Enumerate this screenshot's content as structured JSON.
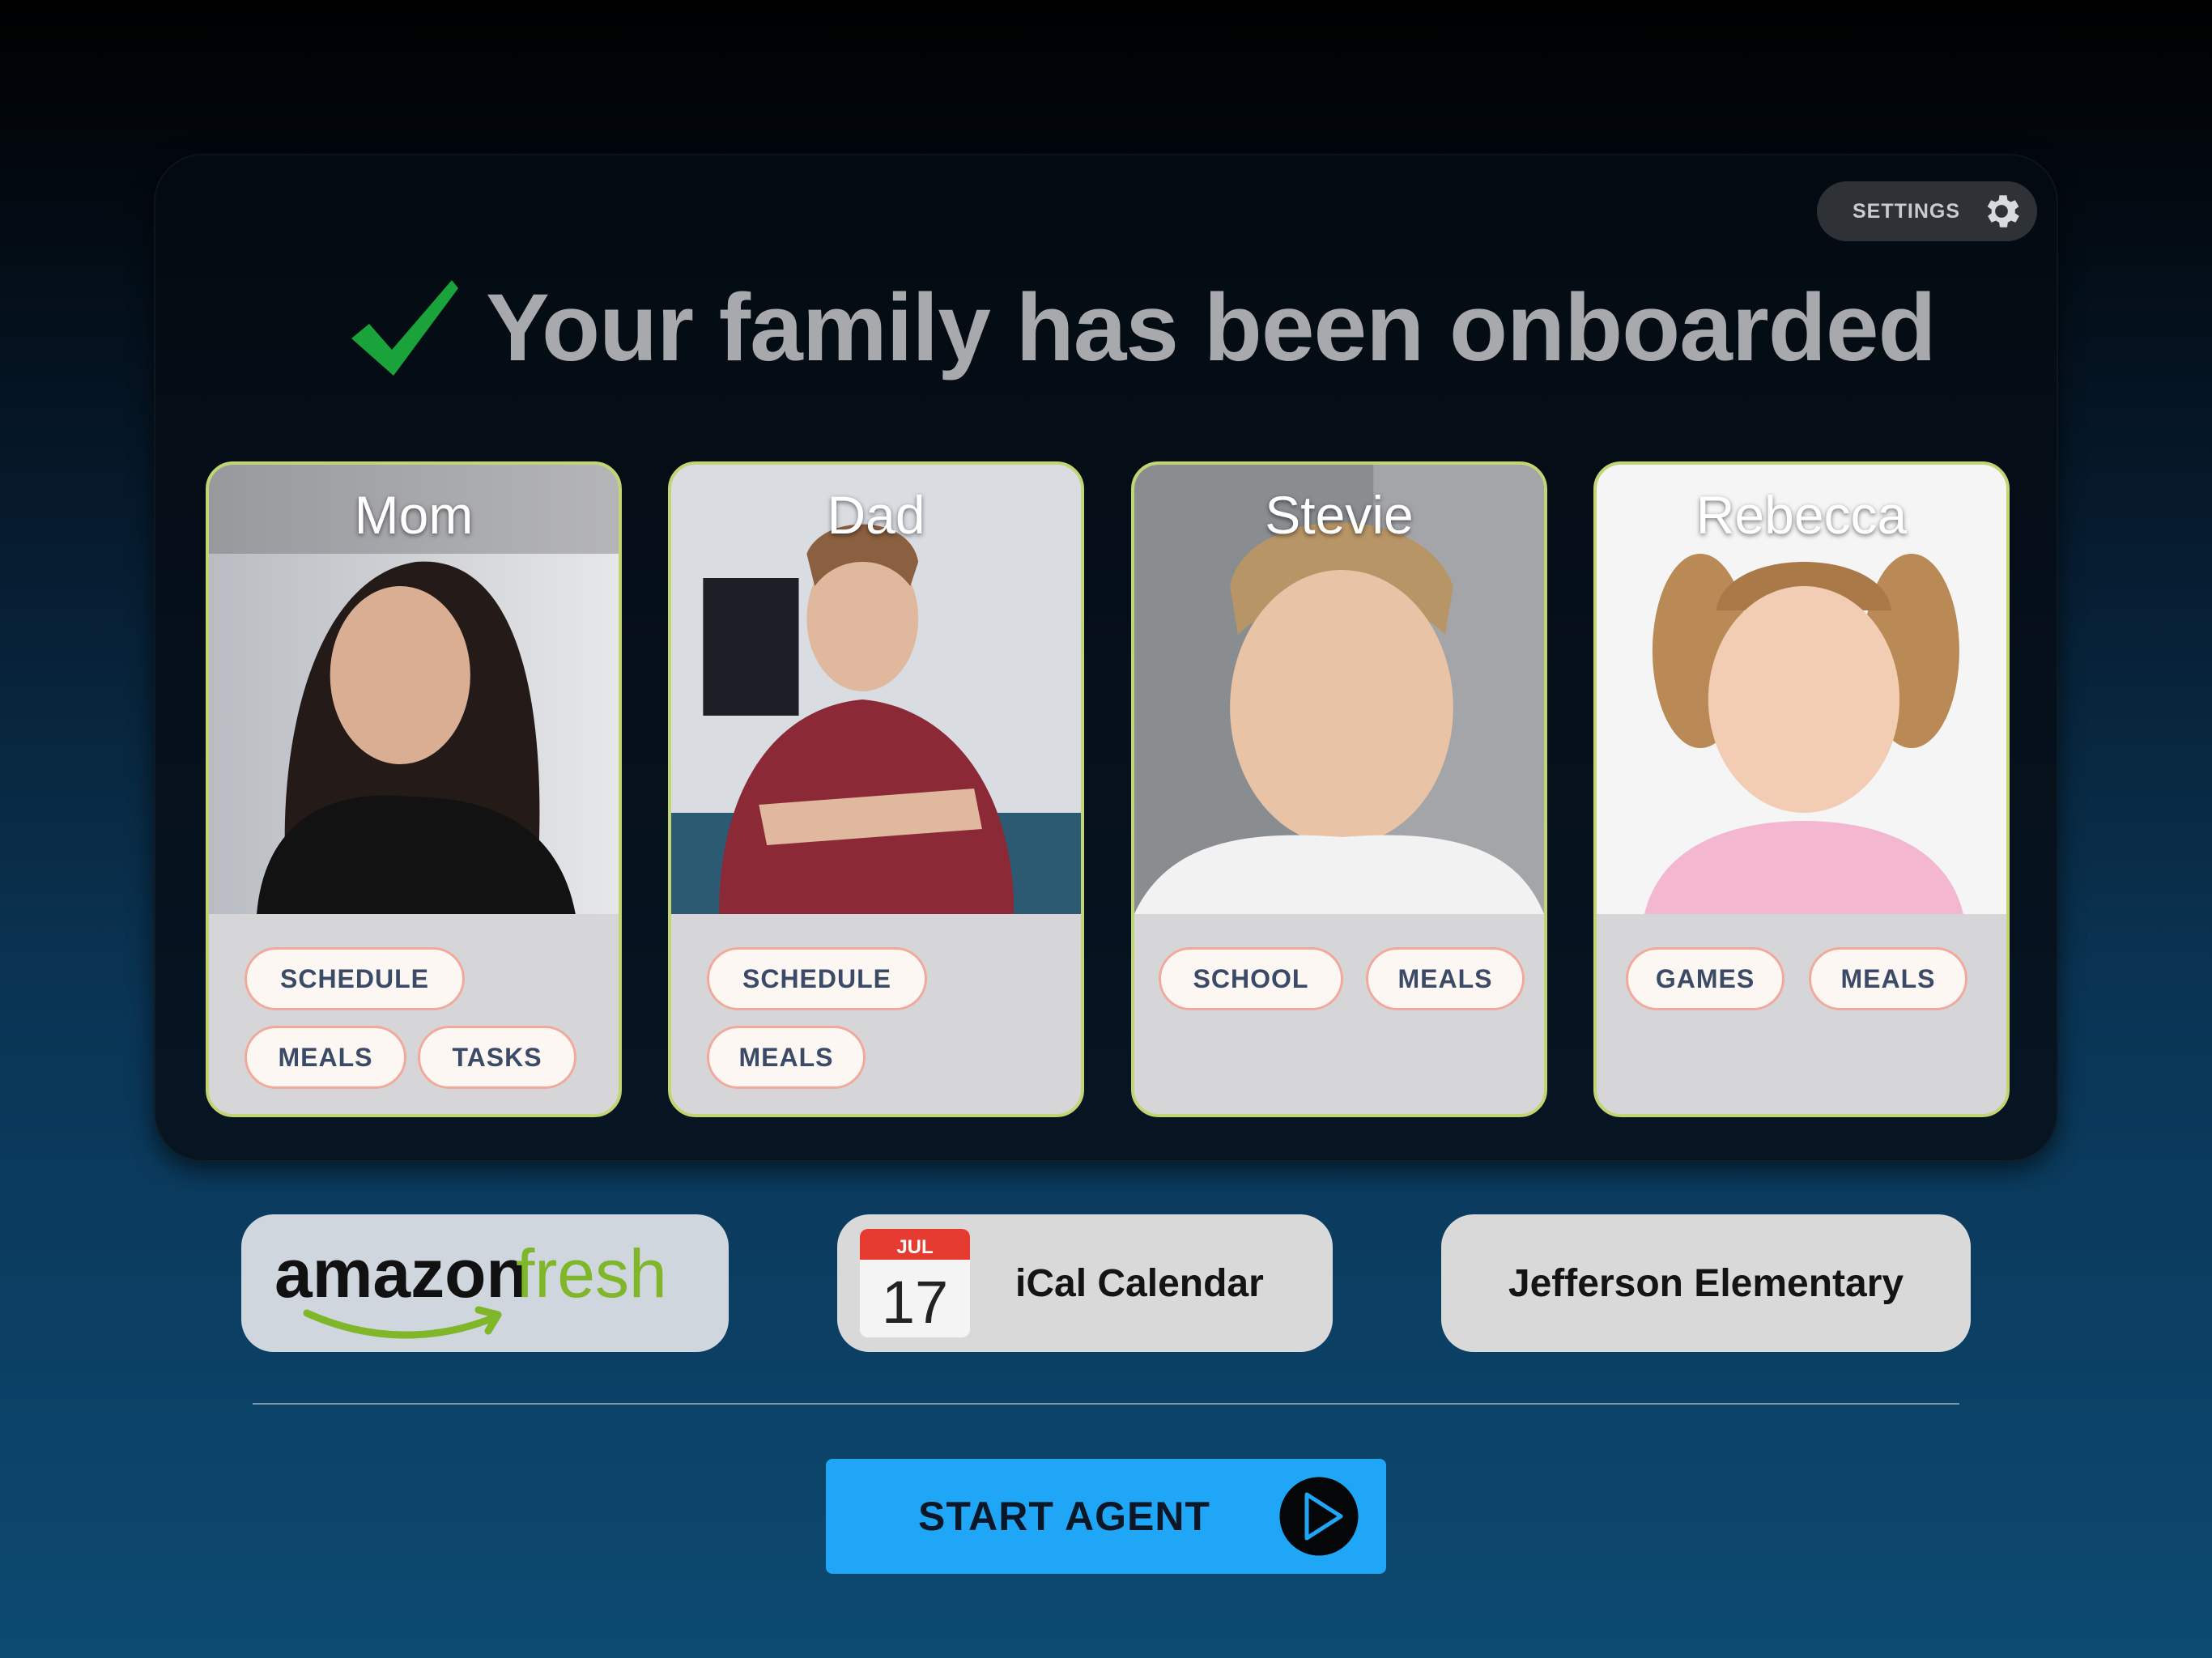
{
  "settings": {
    "label": "SETTINGS",
    "icon": "gear-icon"
  },
  "headline": {
    "text": "Your family has been onboarded",
    "icon": "checkmark-icon",
    "icon_color": "#1aa33a"
  },
  "members": [
    {
      "name": "Mom",
      "tags": [
        "SCHEDULE",
        "MEALS",
        "TASKS"
      ]
    },
    {
      "name": "Dad",
      "tags": [
        "SCHEDULE",
        "MEALS"
      ]
    },
    {
      "name": "Stevie",
      "tags": [
        "SCHOOL",
        "MEALS"
      ]
    },
    {
      "name": "Rebecca",
      "tags": [
        "GAMES",
        "MEALS"
      ]
    }
  ],
  "services": {
    "amazon": {
      "logo_left": "amazon",
      "logo_right": "fresh"
    },
    "ical": {
      "label": "iCal Calendar",
      "month": "JUL",
      "day": "17"
    },
    "school": {
      "label": "Jefferson Elementary"
    }
  },
  "start": {
    "label": "START AGENT",
    "icon": "play-icon"
  },
  "colors": {
    "accent": "#1fa6f6",
    "card_border": "#c3d474",
    "tag_border": "#f1a99c",
    "amazon_green": "#7fb62a"
  }
}
